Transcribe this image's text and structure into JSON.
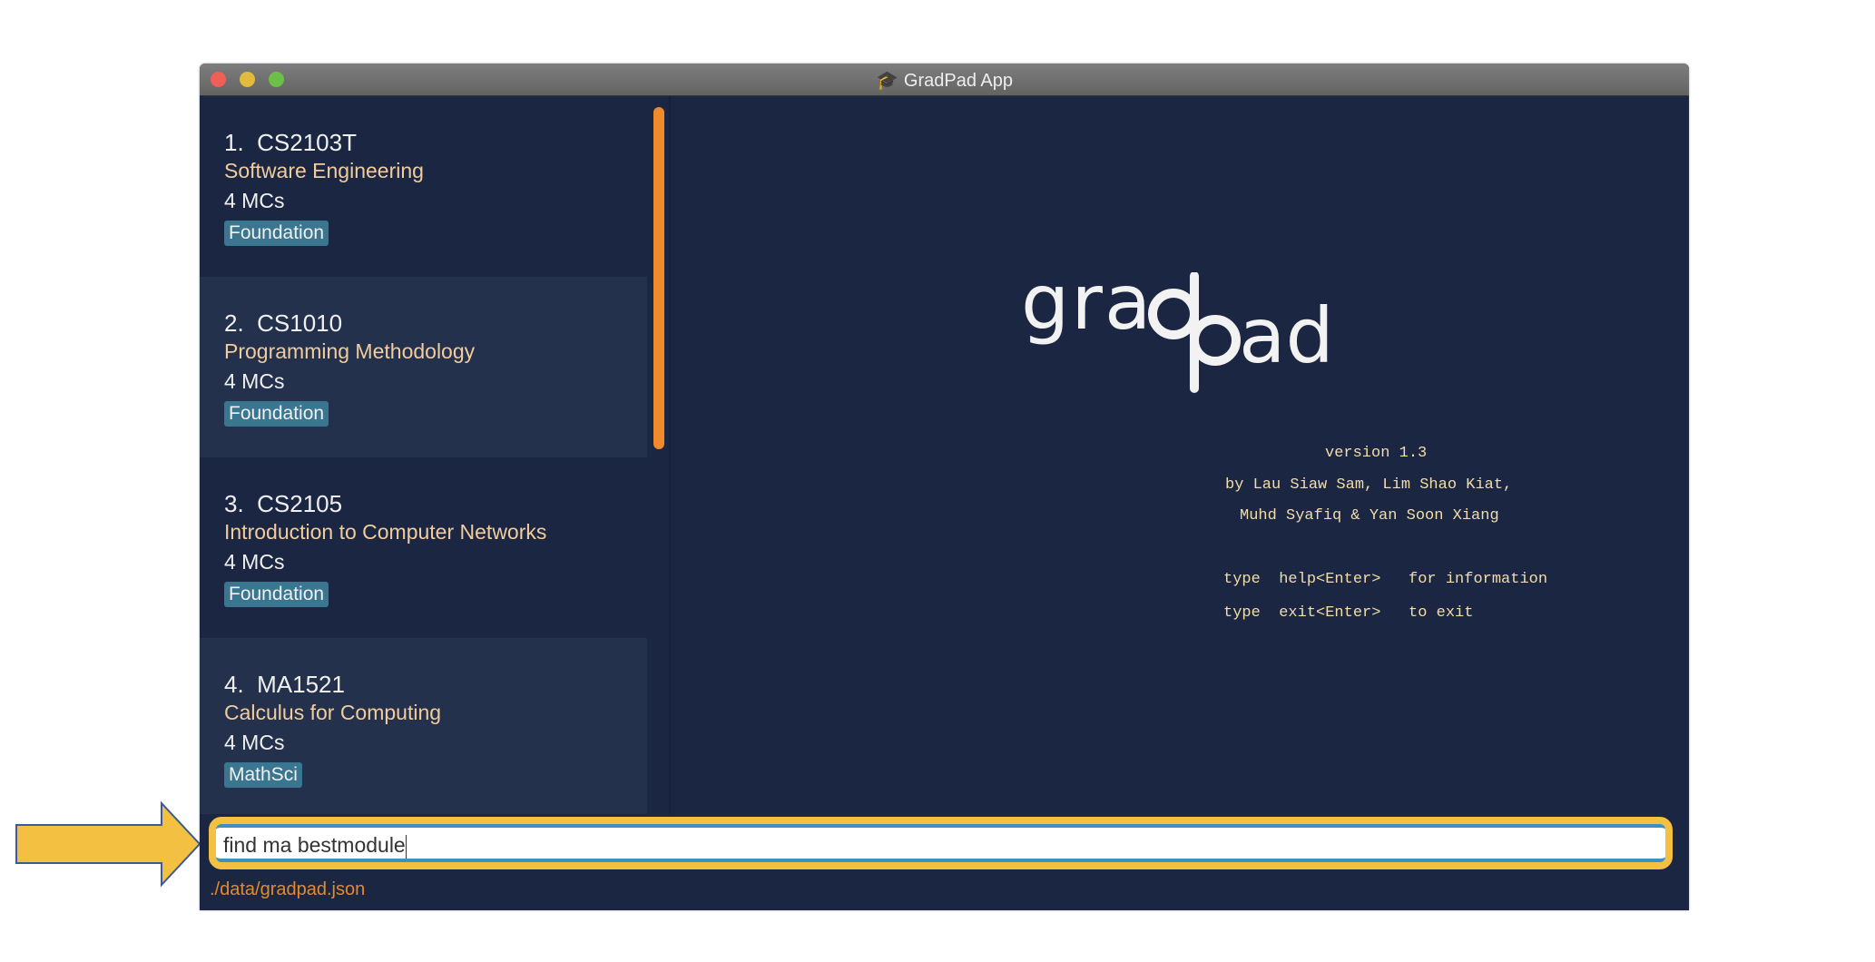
{
  "window": {
    "title": "GradPad App",
    "title_icon": "graduation-cap-icon"
  },
  "modules": [
    {
      "index": "1.",
      "code": "CS2103T",
      "name": "Software Engineering",
      "mcs": "4 MCs",
      "tag": "Foundation"
    },
    {
      "index": "2.",
      "code": "CS1010",
      "name": "Programming Methodology",
      "mcs": "4 MCs",
      "tag": "Foundation"
    },
    {
      "index": "3.",
      "code": "CS2105",
      "name": "Introduction to Computer Networks",
      "mcs": "4 MCs",
      "tag": "Foundation"
    },
    {
      "index": "4.",
      "code": "MA1521",
      "name": "Calculus for Computing",
      "mcs": "4 MCs",
      "tag": "MathSci"
    }
  ],
  "welcome": {
    "logo_text": "gradpad",
    "version": "version 1.3",
    "authors_line1": "by Lau Siaw Sam, Lim Shao Kiat,",
    "authors_line2": "Muhd Syafiq & Yan Soon Xiang",
    "help_line": "type  help<Enter>   for information",
    "exit_line": "type  exit<Enter>   to exit"
  },
  "command": {
    "value": "find ma bestmodule"
  },
  "status": {
    "file_path": "./data/gradpad.json"
  },
  "colors": {
    "background": "#1b2742",
    "accent": "#f08a2c",
    "tag": "#3a7690",
    "highlight": "#f4c042"
  }
}
